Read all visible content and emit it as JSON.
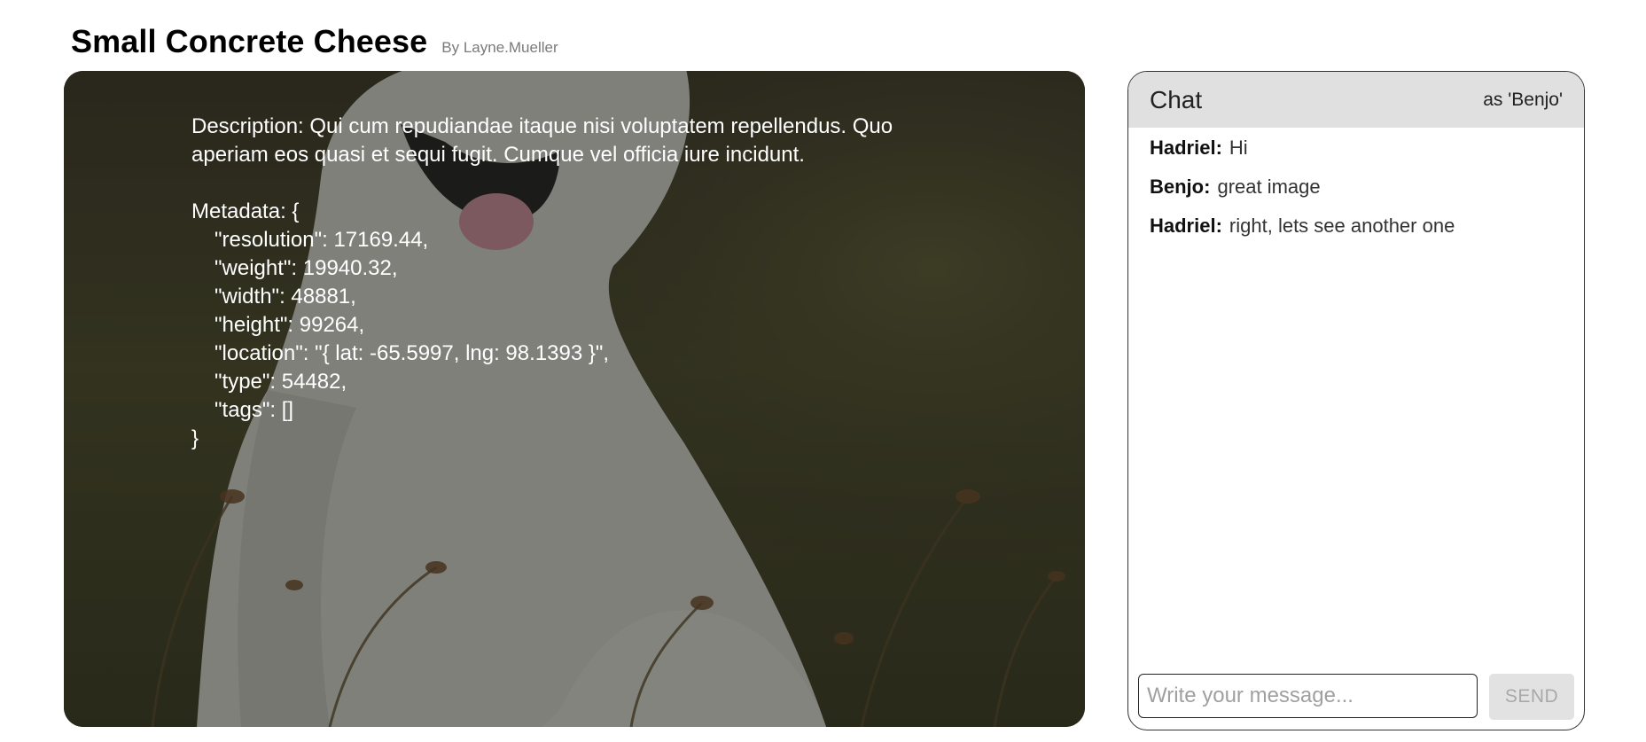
{
  "header": {
    "title": "Small Concrete Cheese",
    "author": "By Layne.Mueller"
  },
  "image": {
    "icon": "dog-photo",
    "description": "Description: Qui cum repudiandae itaque nisi voluptatem repellendus. Quo aperiam eos quasi et sequi fugit. Cumque vel officia iure incidunt.",
    "metadata_open": "Metadata: {",
    "metadata_lines": [
      "\"resolution\": 17169.44,",
      "\"weight\": 19940.32,",
      "\"width\": 48881,",
      "\"height\": 99264,",
      "\"location\": \"{ lat: -65.5997, lng: 98.1393 }\",",
      "\"type\": 54482,",
      "\"tags\": []"
    ],
    "metadata_close": "}"
  },
  "chat": {
    "title": "Chat",
    "user_label": "as 'Benjo'",
    "messages": [
      {
        "author": "Hadriel:",
        "text": "Hi"
      },
      {
        "author": "Benjo:",
        "text": "great image"
      },
      {
        "author": "Hadriel:",
        "text": "right, lets see another one"
      }
    ],
    "input_placeholder": "Write your message...",
    "input_value": "",
    "send_label": "SEND"
  }
}
